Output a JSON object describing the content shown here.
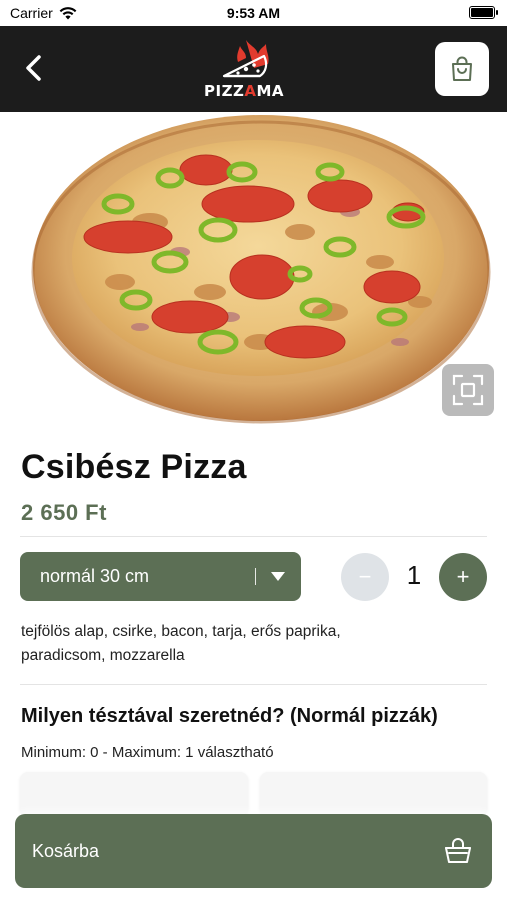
{
  "status_bar": {
    "carrier": "Carrier",
    "time": "9:53 AM"
  },
  "header": {
    "logo_text_start": "PIZZ",
    "logo_text_accent": "A",
    "logo_text_end": "MA",
    "logo_accent_color": "#e23b2e",
    "background_color": "#1c1c1c",
    "icons": {
      "back": "chevron-left-icon",
      "cart": "shopping-bag-icon"
    }
  },
  "hero": {
    "image": "pizza-photo",
    "expand_icon": "fullscreen-icon"
  },
  "product": {
    "title": "Csibész Pizza",
    "price": "2 650 Ft",
    "size_selected": "normál 30 cm",
    "quantity": "1",
    "minus_label": "−",
    "plus_label": "+",
    "ingredients": "tejfölös alap, csirke, bacon, tarja, erős paprika, paradicsom, mozzarella"
  },
  "options_section": {
    "title": "Milyen tésztával szeretnéd? (Normál pizzák)",
    "subtitle": "Minimum: 0 - Maximum: 1 választható"
  },
  "footer": {
    "add_to_cart_label": "Kosárba",
    "icon": "basket-icon"
  },
  "colors": {
    "accent_green": "#5c6f55",
    "minus_button_bg": "#dfe3e7"
  }
}
